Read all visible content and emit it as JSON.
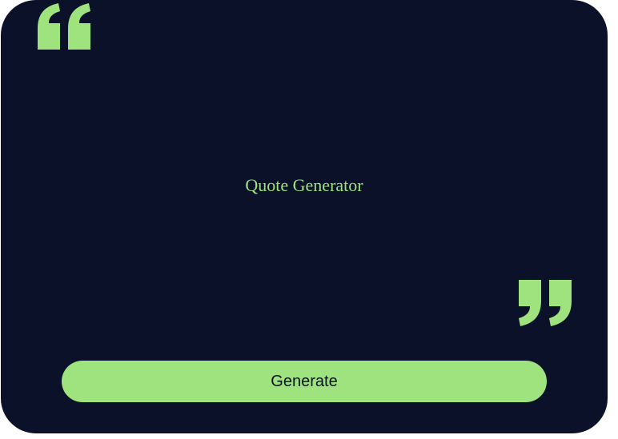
{
  "theme": {
    "background": "#0a1128",
    "accent": "#9ee37d",
    "button_text": "#0a1128"
  },
  "icons": {
    "open_quote": "opening-quotation-mark",
    "close_quote": "closing-quotation-mark"
  },
  "quote": {
    "text": "Quote Generator"
  },
  "controls": {
    "generate_label": "Generate"
  }
}
